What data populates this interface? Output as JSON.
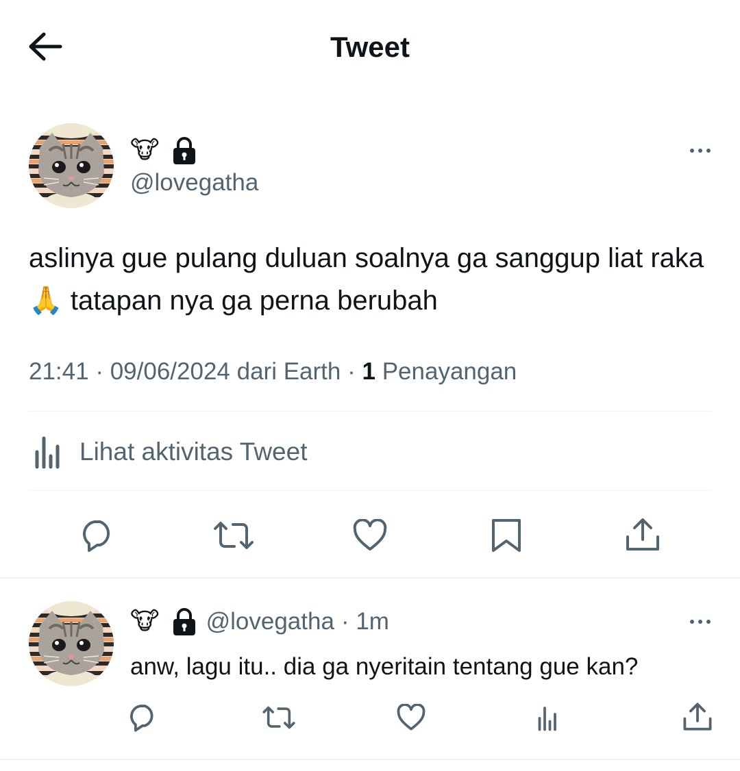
{
  "header": {
    "title": "Tweet"
  },
  "tweet": {
    "author": {
      "name_emoji": "🐮",
      "handle": "@lovegatha"
    },
    "text": "aslinya gue pulang duluan soalnya ga sanggup liat raka 🙏 tatapan nya ga perna berubah",
    "time": "21:41",
    "date": "09/06/2024",
    "source": "dari Earth",
    "separator": "·",
    "views_count": "1",
    "views_label": "Penayangan",
    "activity_label": "Lihat aktivitas Tweet"
  },
  "reply": {
    "author": {
      "name_emoji": "🐮",
      "handle": "@lovegatha",
      "time": "· 1m"
    },
    "text": "anw, lagu itu.. dia ga nyeritain tentang gue kan?"
  },
  "colors": {
    "text": "#0f1419",
    "secondary": "#536471",
    "divider": "#eff3f4"
  }
}
